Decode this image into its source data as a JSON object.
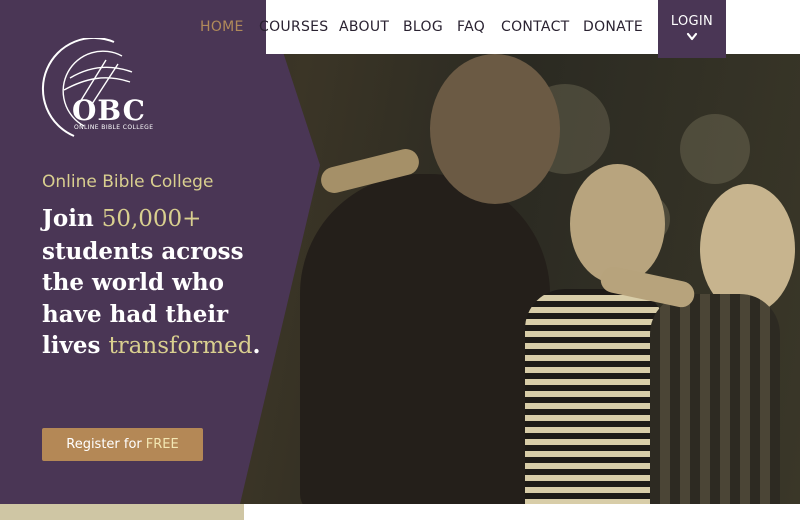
{
  "nav": {
    "items": [
      {
        "label": "HOME",
        "active": true
      },
      {
        "label": "COURSES",
        "active": false
      },
      {
        "label": "ABOUT",
        "active": false
      },
      {
        "label": "BLOG",
        "active": false
      },
      {
        "label": "FAQ",
        "active": false
      },
      {
        "label": "CONTACT",
        "active": false
      },
      {
        "label": "DONATE",
        "active": false
      }
    ],
    "login_label": "LOGIN"
  },
  "logo": {
    "letters": "OBC",
    "tagline": "ONLINE BIBLE COLLEGE"
  },
  "hero": {
    "eyebrow": "Online Bible College",
    "headline_part1": "Join ",
    "headline_count": "50,000+",
    "headline_part2": " students across the world who have had their lives ",
    "headline_accent": "transformed",
    "headline_end": ".",
    "cta_prefix": "Register for",
    "cta_free": "FREE"
  },
  "colors": {
    "purple": "#4a3655",
    "gold": "#d9cf8f",
    "button": "#b48856",
    "active_nav": "#b08a5a"
  }
}
